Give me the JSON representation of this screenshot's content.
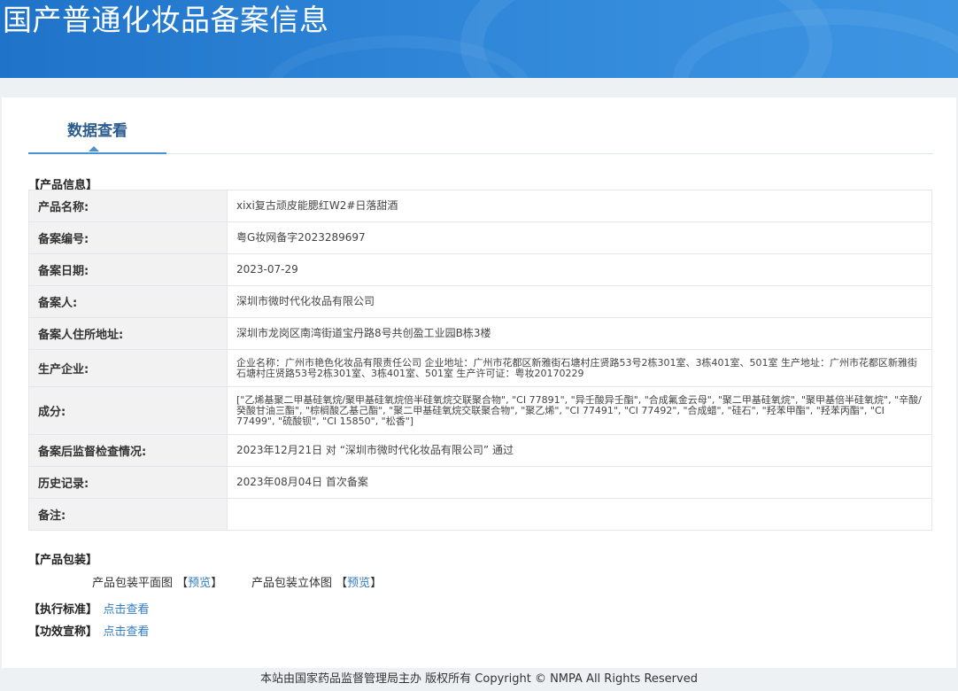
{
  "header": {
    "title": "国产普通化妆品备案信息"
  },
  "tabs": [
    {
      "label": "数据查看"
    }
  ],
  "product_info": {
    "section_title": "【产品信息】",
    "rows": [
      {
        "label": "产品名称:",
        "value": "xixi复古顽皮能腮红W2#日落甜酒"
      },
      {
        "label": "备案编号:",
        "value": "粤G妆网备字2023289697"
      },
      {
        "label": "备案日期:",
        "value": "2023-07-29"
      },
      {
        "label": "备案人:",
        "value": "深圳市微时代化妆品有限公司"
      },
      {
        "label": "备案人住所地址:",
        "value": "深圳市龙岗区南湾街道宝丹路8号共创盈工业园B栋3楼"
      },
      {
        "label": "生产企业:",
        "value": "企业名称：广州市艳色化妆品有限责任公司 企业地址：广州市花都区新雅街石塘村庄贤路53号2栋301室、3栋401室、501室 生产地址：广州市花都区新雅街石塘村庄贤路53号2栋301室、3栋401室、501室 生产许可证：粤妆20170229"
      },
      {
        "label": "成分:",
        "value": "[\"乙烯基聚二甲基硅氧烷/聚甲基硅氧烷倍半硅氧烷交联聚合物\", \"CI 77891\", \"异壬酸异壬酯\", \"合成氟金云母\", \"聚二甲基硅氧烷\", \"聚甲基倍半硅氧烷\", \"辛酸/癸酸甘油三酯\", \"棕榈酸乙基己酯\", \"聚二甲基硅氧烷交联聚合物\", \"聚乙烯\", \"CI 77491\", \"CI 77492\", \"合成蜡\", \"硅石\", \"羟苯甲酯\", \"羟苯丙酯\", \"CI 77499\", \"硫酸钡\", \"CI 15850\", \"松香\"]"
      },
      {
        "label": "备案后监督检查情况:",
        "value": "2023年12月21日 对 “深圳市微时代化妆品有限公司” 通过"
      },
      {
        "label": "历史记录:",
        "value": "2023年08月04日 首次备案"
      },
      {
        "label": "备注:",
        "value": ""
      }
    ]
  },
  "packaging": {
    "section_title": "【产品包装】",
    "flat_label": "产品包装平面图",
    "flat_link": "预览",
    "stereo_label": "产品包装立体图",
    "stereo_link": "预览"
  },
  "standards": {
    "label": "【执行标准】",
    "link": "点击查看"
  },
  "efficacy": {
    "label": "【功效宣称】",
    "link": "点击查看"
  },
  "footer": {
    "text": "本站由国家药品监督管理局主办 版权所有 Copyright © NMPA All Rights Reserved"
  }
}
